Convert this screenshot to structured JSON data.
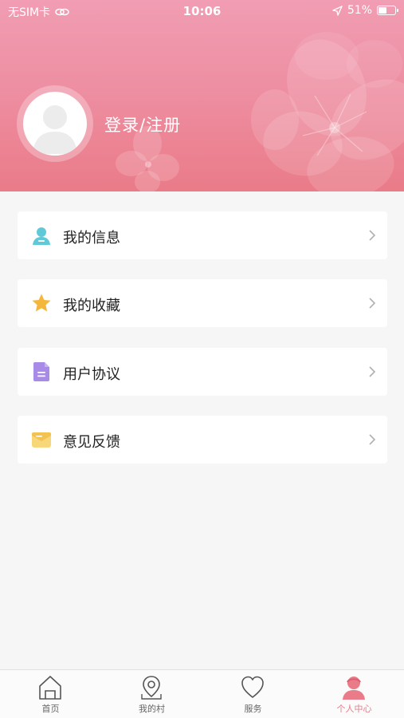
{
  "status_bar": {
    "carrier": "无SIM卡",
    "time": "10:06",
    "battery": "51%",
    "battery_level": 0.51
  },
  "profile": {
    "login_label": "登录/注册"
  },
  "menu": [
    {
      "label": "我的信息",
      "icon": "user-info-icon"
    },
    {
      "label": "我的收藏",
      "icon": "star-icon"
    },
    {
      "label": "用户协议",
      "icon": "document-icon"
    },
    {
      "label": "意见反馈",
      "icon": "envelope-icon"
    }
  ],
  "tabbar": {
    "items": [
      {
        "label": "首页",
        "icon": "home-icon"
      },
      {
        "label": "我的村",
        "icon": "location-pin-icon"
      },
      {
        "label": "服务",
        "icon": "heart-icon"
      },
      {
        "label": "个人中心",
        "icon": "person-icon",
        "active": true
      }
    ]
  },
  "colors": {
    "accent": "#ea7b88",
    "header_top": "#f19db3",
    "header_bottom": "#ea7b88"
  }
}
